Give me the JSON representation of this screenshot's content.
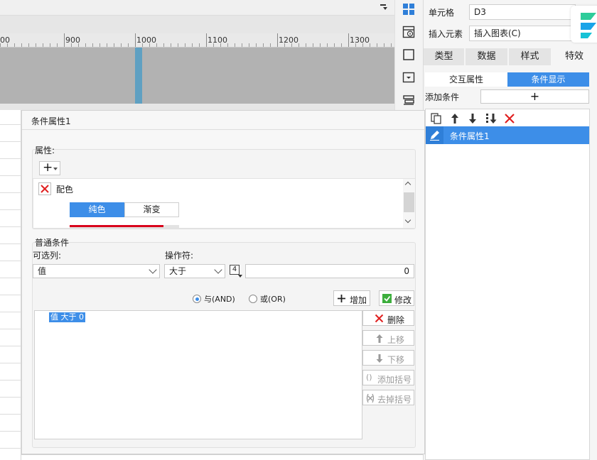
{
  "ruler": {
    "labels": [
      "00",
      "900",
      "1000",
      "1100",
      "1200",
      "1300"
    ]
  },
  "right_panel": {
    "cell_label": "单元格",
    "cell_value": "D3",
    "insert_label": "插入元素",
    "insert_value": "插入图表(C)",
    "tabs": [
      "类型",
      "数据",
      "样式",
      "特效"
    ],
    "subtabs": [
      "交互属性",
      "条件显示"
    ],
    "add_condition_label": "添加条件",
    "add_condition_button": "+",
    "list_items": [
      "条件属性1"
    ]
  },
  "dialog": {
    "title": "条件属性1",
    "properties_label": "属性:",
    "add_button": "+",
    "property_item": "配色",
    "color_tabs": [
      "纯色",
      "渐变"
    ],
    "normal_conditions_label": "普通条件",
    "column_label": "可选列:",
    "column_value": "值",
    "operator_label": "操作符:",
    "operator_value": "大于",
    "type_icon_label": "4",
    "value_input": "0",
    "radio_and": "与(AND)",
    "radio_or": "或(OR)",
    "add_btn": "增加",
    "modify_btn": "修改",
    "condition_entry": "值 大于 0",
    "delete_btn": "删除",
    "move_up_btn": "上移",
    "move_down_btn": "下移",
    "add_bracket_btn": "添加括号",
    "remove_bracket_btn": "去掉括号"
  },
  "colors": {
    "accent": "#3d8ee8",
    "red": "#e02020",
    "progress_red": "#d9001b"
  }
}
